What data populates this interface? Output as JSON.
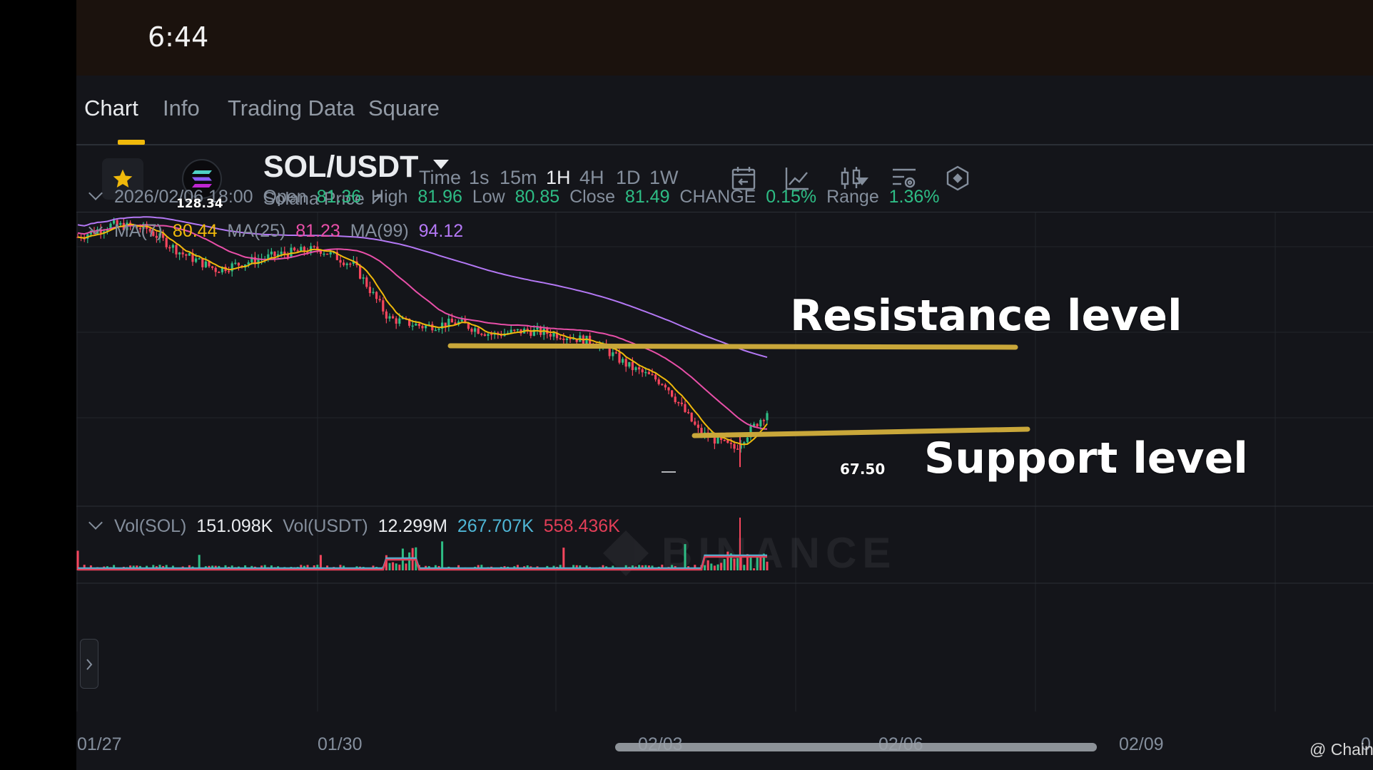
{
  "status_bar": {
    "time": "6:44"
  },
  "tabs": [
    {
      "label": "Chart",
      "active": true
    },
    {
      "label": "Info",
      "active": false
    },
    {
      "label": "Trading Data",
      "active": false
    },
    {
      "label": "Square",
      "active": false
    }
  ],
  "pair": {
    "symbol": "SOL/USDT",
    "subtitle": "Solana Price ↗",
    "favorite_icon": "star-icon",
    "logo_icon": "solana-logo-icon"
  },
  "timeframes": [
    {
      "label": "Time",
      "active": false
    },
    {
      "label": "1s",
      "active": false
    },
    {
      "label": "15m",
      "active": false
    },
    {
      "label": "1H",
      "active": true
    },
    {
      "label": "4H",
      "active": false
    },
    {
      "label": "1D",
      "active": false
    },
    {
      "label": "1W",
      "active": false
    }
  ],
  "toolbar_icons": [
    "calendar-icon",
    "line-chart-icon",
    "candlestick-icon",
    "chart-settings-icon",
    "indicator-icon"
  ],
  "ohlc": {
    "datetime": "2026/02/06 18:00",
    "open_label": "Open",
    "open": "81.36",
    "high_label": "High",
    "high": "81.96",
    "low_label": "Low",
    "low": "80.85",
    "close_label": "Close",
    "close": "81.49",
    "change_label": "CHANGE",
    "change": "0.15%",
    "range_label": "Range",
    "range": "1.36%"
  },
  "ma": {
    "ma7_label": "MA(7)",
    "ma7": "80.44",
    "ma25_label": "MA(25)",
    "ma25": "81.23",
    "ma99_label": "MA(99)",
    "ma99": "94.12"
  },
  "volume": {
    "sol_label": "Vol(SOL)",
    "sol": "151.098K",
    "usdt_label": "Vol(USDT)",
    "usdt": "12.299M",
    "ma5": "267.707K",
    "ma10": "558.436K"
  },
  "price_markers": {
    "high": "128.34",
    "low": "67.50"
  },
  "annotations": {
    "resistance": "Resistance level",
    "support": "Support level"
  },
  "x_axis": [
    "01/27",
    "01/30",
    "02/03",
    "02/06",
    "02/09",
    "0"
  ],
  "credit": "@ ChainEthos",
  "colors": {
    "up": "#2ebd85",
    "down": "#f6465d",
    "ma7": "#f0b90b",
    "ma25": "#e84fa8",
    "ma99": "#b478f5",
    "level_line": "#c9a73a",
    "accent": "#f0b90b"
  },
  "chart_data": {
    "type": "candlestick",
    "interval": "1H",
    "x_range": [
      "01/27",
      "02/09"
    ],
    "price_path": [
      [
        "01/27",
        124
      ],
      [
        "01/28",
        127
      ],
      [
        "01/28",
        126
      ],
      [
        "01/29",
        120
      ],
      [
        "01/29",
        116
      ],
      [
        "01/30",
        118
      ],
      [
        "01/31",
        120
      ],
      [
        "01/31",
        121
      ],
      [
        "02/01",
        117
      ],
      [
        "02/01",
        104
      ],
      [
        "02/02",
        102
      ],
      [
        "02/02",
        103
      ],
      [
        "02/03",
        100
      ],
      [
        "02/03",
        101
      ],
      [
        "02/04",
        100
      ],
      [
        "02/04",
        98
      ],
      [
        "02/05",
        92
      ],
      [
        "02/05",
        88
      ],
      [
        "02/06",
        76
      ],
      [
        "02/06",
        72
      ],
      [
        "02/06",
        81.49
      ]
    ],
    "marked_high": 128.34,
    "marked_low": 67.5,
    "ma_series": [
      {
        "name": "MA(7)",
        "last": 80.44
      },
      {
        "name": "MA(25)",
        "last": 81.23
      },
      {
        "name": "MA(99)",
        "last": 94.12
      }
    ]
  }
}
